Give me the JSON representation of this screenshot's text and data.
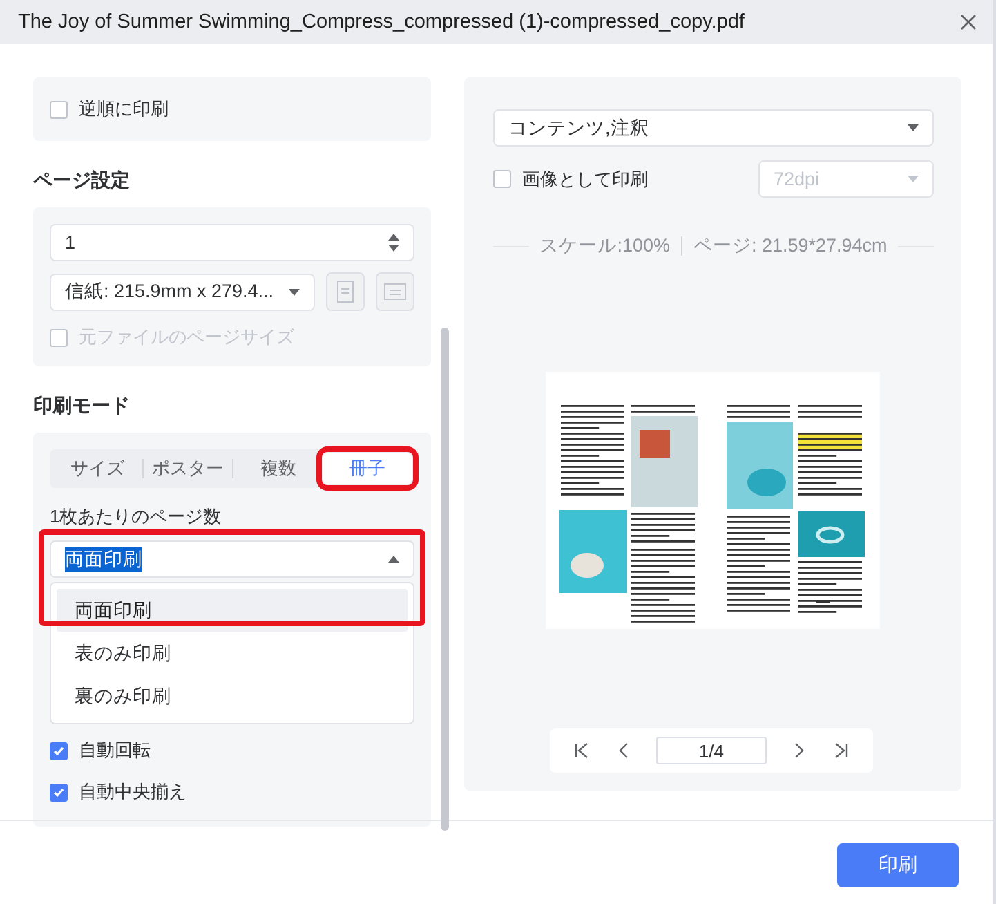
{
  "window": {
    "title": "The Joy of Summer Swimming_Compress_compressed (1)-compressed_copy.pdf"
  },
  "left": {
    "reverse_order": {
      "label": "逆順に印刷",
      "checked": false
    },
    "page_setup": {
      "heading": "ページ設定",
      "copies": "1",
      "paper": "信紙: 215.9mm x 279.4...",
      "original_size": {
        "label": "元ファイルのページサイズ",
        "checked": false,
        "disabled": true
      }
    },
    "print_mode": {
      "heading": "印刷モード",
      "tabs": [
        {
          "label": "サイズ",
          "selected": false,
          "annotated": false
        },
        {
          "label": "ポスター",
          "selected": false,
          "annotated": false
        },
        {
          "label": "複数",
          "selected": false,
          "annotated": false
        },
        {
          "label": "冊子",
          "selected": true,
          "annotated": true
        }
      ],
      "pages_label": "1枚あたりのページ数",
      "select": {
        "value": "両面印刷",
        "expanded": true,
        "annotated": true
      },
      "options": [
        {
          "label": "両面印刷",
          "selected": true
        },
        {
          "label": "表のみ印刷",
          "selected": false
        },
        {
          "label": "裏のみ印刷",
          "selected": false
        }
      ],
      "checks": [
        {
          "label": "自動回転",
          "checked": true
        },
        {
          "label": "自動中央揃え",
          "checked": true
        }
      ]
    }
  },
  "right": {
    "content": "コンテンツ,注釈",
    "image_print": {
      "label": "画像として印刷",
      "checked": false
    },
    "dpi": {
      "value": "72dpi",
      "disabled": true
    },
    "scale": "スケール:100%",
    "page_size": "ページ: 21.59*27.94cm",
    "pager": "1/4"
  },
  "print_button": "印刷"
}
